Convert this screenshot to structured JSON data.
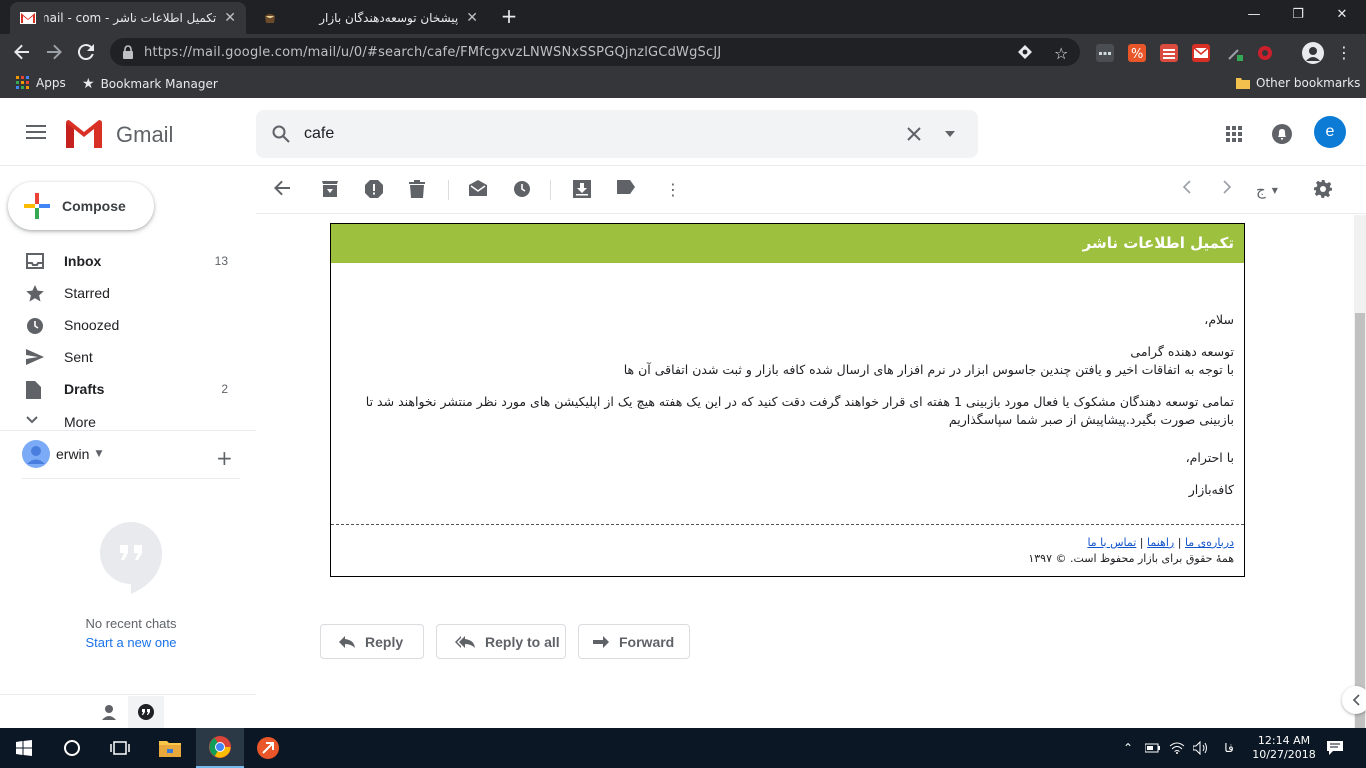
{
  "browser": {
    "tabs": [
      {
        "title": "تکمیل اطلاعات ناشر - Gmail - com",
        "active": true
      },
      {
        "title": "پیشخان توسعه‌دهندگان بازار",
        "active": false
      }
    ],
    "url": "https://mail.google.com/mail/u/0/#search/cafe/FMfcgxvzLNWSNxSSPGQjnzlGCdWgScJJ",
    "extension_badges": {
      "first": "3",
      "second": "35"
    },
    "bookmarks": {
      "apps": "Apps",
      "manager": "Bookmark Manager",
      "other": "Other bookmarks"
    }
  },
  "gmail": {
    "product_name": "Gmail",
    "search_value": "cafe",
    "avatar_letter": "e",
    "compose_label": "Compose",
    "nav": [
      {
        "label": "Inbox",
        "count": "13",
        "icon": "inbox-icon"
      },
      {
        "label": "Starred",
        "count": "",
        "icon": "star-icon"
      },
      {
        "label": "Snoozed",
        "count": "",
        "icon": "clock-icon"
      },
      {
        "label": "Sent",
        "count": "",
        "icon": "send-icon"
      },
      {
        "label": "Drafts",
        "count": "2",
        "icon": "draft-icon"
      },
      {
        "label": "More",
        "count": "",
        "icon": "chevron-down-icon"
      }
    ],
    "hangouts": {
      "user": "erwin",
      "no_chats": "No recent chats",
      "start_new": "Start a new one"
    }
  },
  "email": {
    "header": "تکمیل اطلاعات ناشر",
    "greeting": "سلام،",
    "salutation": "توسعه دهنده گرامی",
    "line1": "با توجه به اتفاقات اخیر و یافتن چندین جاسوس ابزار در نرم افزار های ارسال شده کافه بازار و ثبت شدن اتفاقی آن ها",
    "paragraph": "تمامی توسعه دهندگان مشکوک یا فعال مورد بازبینی 1 هفته ای قرار خواهند گرفت دقت کنید که در این یک هفته هیچ یک از اپلیکیشن های مورد نظر منتشر نخواهند شد تا بازبینی صورت بگیرد.پیشاپیش از صبر شما سپاسگذاریم",
    "closing": "با احترام،",
    "signature": "کافه‌بازار",
    "footer_links": [
      "درباره‌ی ما",
      "راهنما",
      "تماس با ما"
    ],
    "footer_sep": "|",
    "copyright": "همهٔ حقوق برای بازار محفوظ است. © ۱۳۹۷"
  },
  "actions": {
    "reply": "Reply",
    "reply_all": "Reply to all",
    "forward": "Forward"
  },
  "taskbar": {
    "lang": "فا",
    "time": "12:14 AM",
    "date": "10/27/2018"
  },
  "colors": {
    "email_header": "#9dc03f",
    "gmail_red": "#d93025",
    "avatar": "#0b7bd6"
  }
}
